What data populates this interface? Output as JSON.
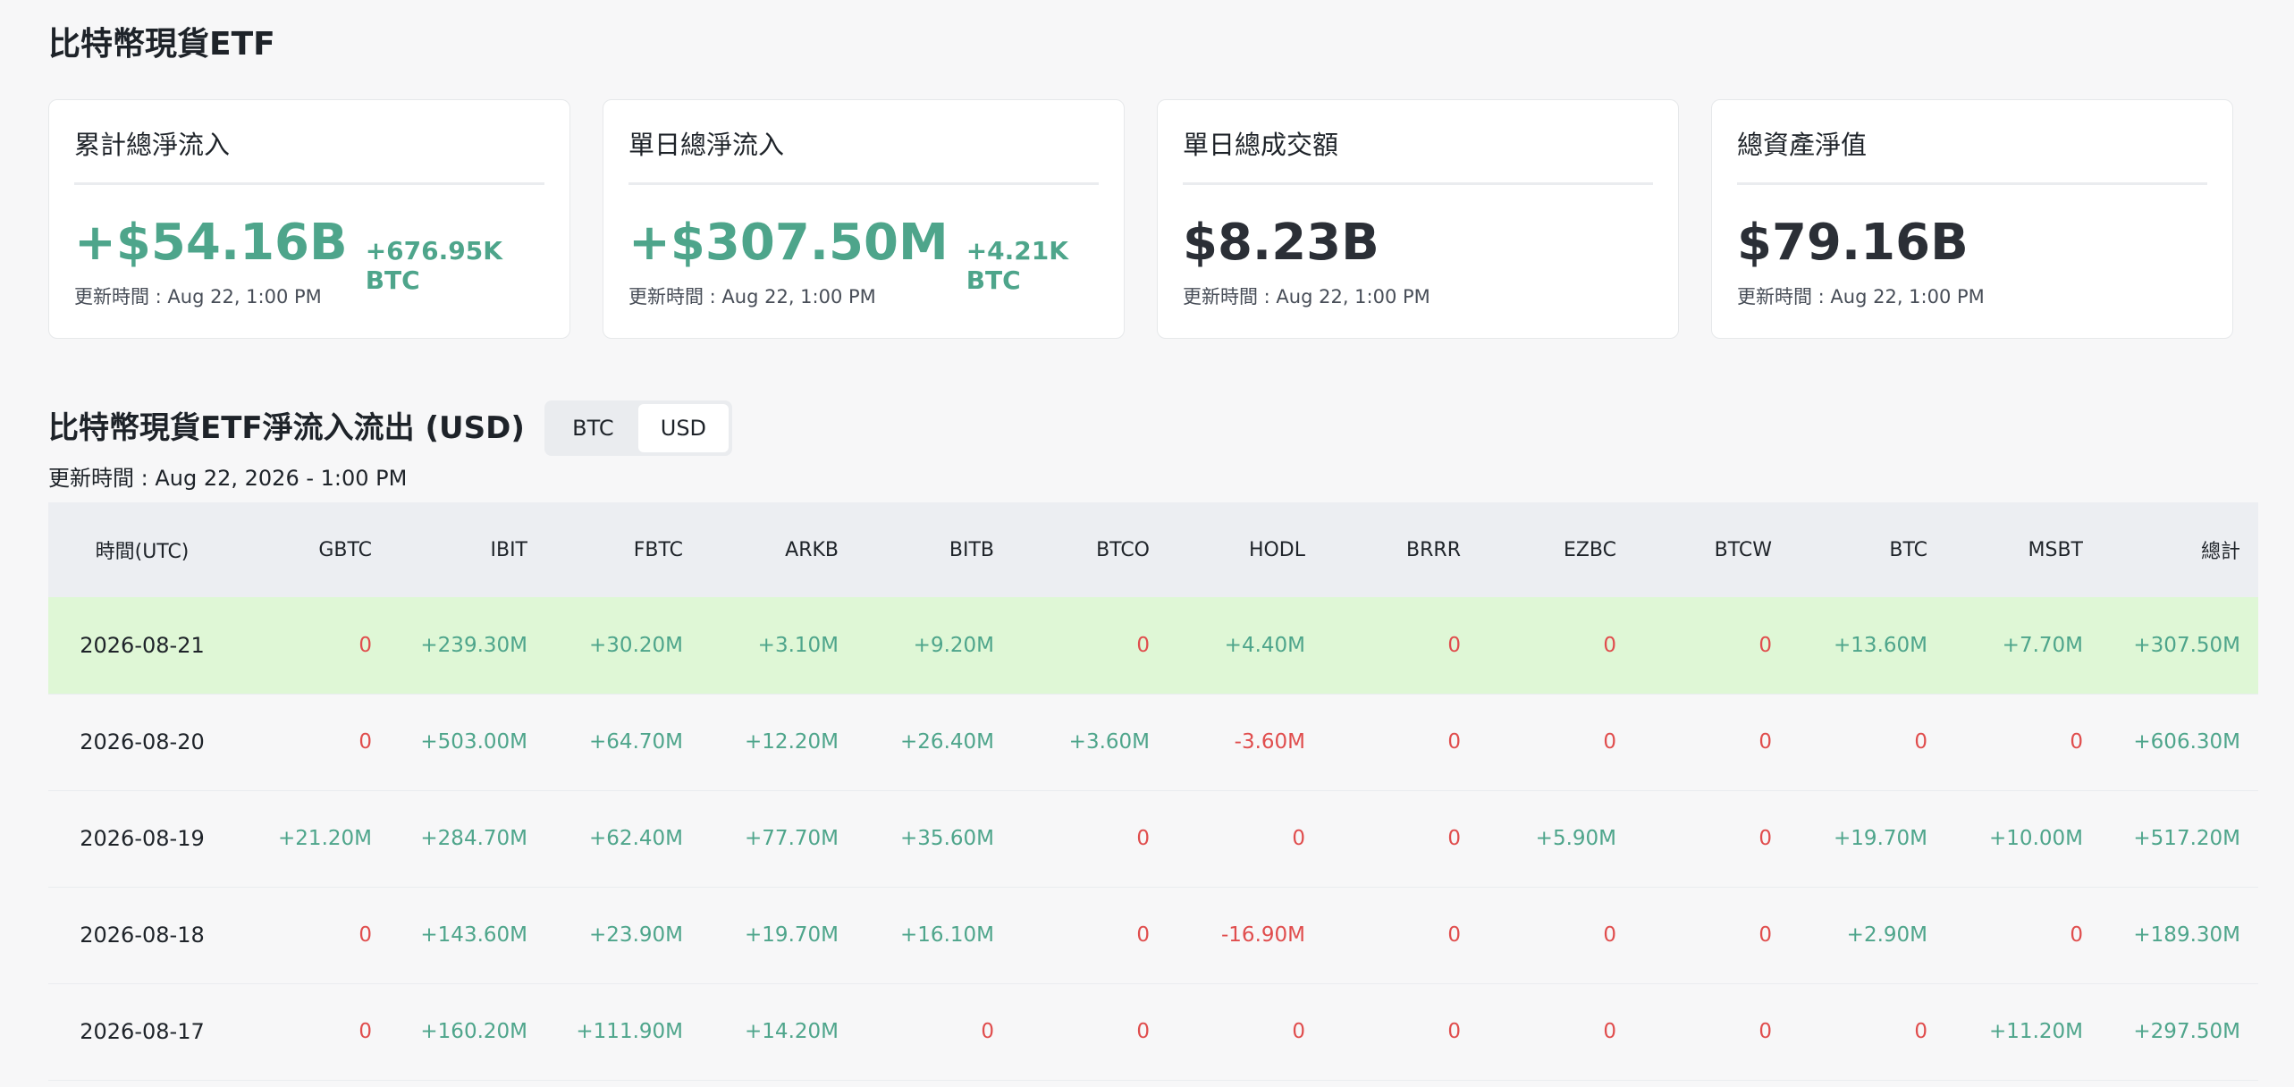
{
  "page_title": "比特幣現貨ETF",
  "cards": [
    {
      "title": "累計總淨流入",
      "value": "+$54.16B",
      "sub": "+676.95K BTC",
      "updated": "更新時間 : Aug 22, 1:00 PM",
      "tone": "pos"
    },
    {
      "title": "單日總淨流入",
      "value": "+$307.50M",
      "sub": "+4.21K BTC",
      "updated": "更新時間 : Aug 22, 1:00 PM",
      "tone": "pos"
    },
    {
      "title": "單日總成交額",
      "value": "$8.23B",
      "sub": "",
      "updated": "更新時間 : Aug 22, 1:00 PM",
      "tone": "neutral"
    },
    {
      "title": "總資產淨值",
      "value": "$79.16B",
      "sub": "",
      "updated": "更新時間 : Aug 22, 1:00 PM",
      "tone": "neutral"
    }
  ],
  "flows": {
    "title": "比特幣現貨ETF淨流入流出 (USD)",
    "toggle": {
      "btc_label": "BTC",
      "usd_label": "USD",
      "selected": "USD"
    },
    "updated": "更新時間 : Aug 22, 2026 - 1:00 PM",
    "columns": [
      "時間(UTC)",
      "GBTC",
      "IBIT",
      "FBTC",
      "ARKB",
      "BITB",
      "BTCO",
      "HODL",
      "BRRR",
      "EZBC",
      "BTCW",
      "BTC",
      "MSBT",
      "總計"
    ],
    "rows": [
      [
        "2026-08-21",
        "0",
        "+239.30M",
        "+30.20M",
        "+3.10M",
        "+9.20M",
        "0",
        "+4.40M",
        "0",
        "0",
        "0",
        "+13.60M",
        "+7.70M",
        "+307.50M"
      ],
      [
        "2026-08-20",
        "0",
        "+503.00M",
        "+64.70M",
        "+12.20M",
        "+26.40M",
        "+3.60M",
        "-3.60M",
        "0",
        "0",
        "0",
        "0",
        "0",
        "+606.30M"
      ],
      [
        "2026-08-19",
        "+21.20M",
        "+284.70M",
        "+62.40M",
        "+77.70M",
        "+35.60M",
        "0",
        "0",
        "0",
        "+5.90M",
        "0",
        "+19.70M",
        "+10.00M",
        "+517.20M"
      ],
      [
        "2026-08-18",
        "0",
        "+143.60M",
        "+23.90M",
        "+19.70M",
        "+16.10M",
        "0",
        "-16.90M",
        "0",
        "0",
        "0",
        "+2.90M",
        "0",
        "+189.30M"
      ],
      [
        "2026-08-17",
        "0",
        "+160.20M",
        "+111.90M",
        "+14.20M",
        "0",
        "0",
        "0",
        "0",
        "0",
        "0",
        "0",
        "+11.20M",
        "+297.50M"
      ]
    ],
    "highlighted_row": "2026-08-21"
  },
  "colors": {
    "positive": "#4ea58b",
    "negative": "#e04d4d",
    "highlight_row": "#dff7d6"
  }
}
